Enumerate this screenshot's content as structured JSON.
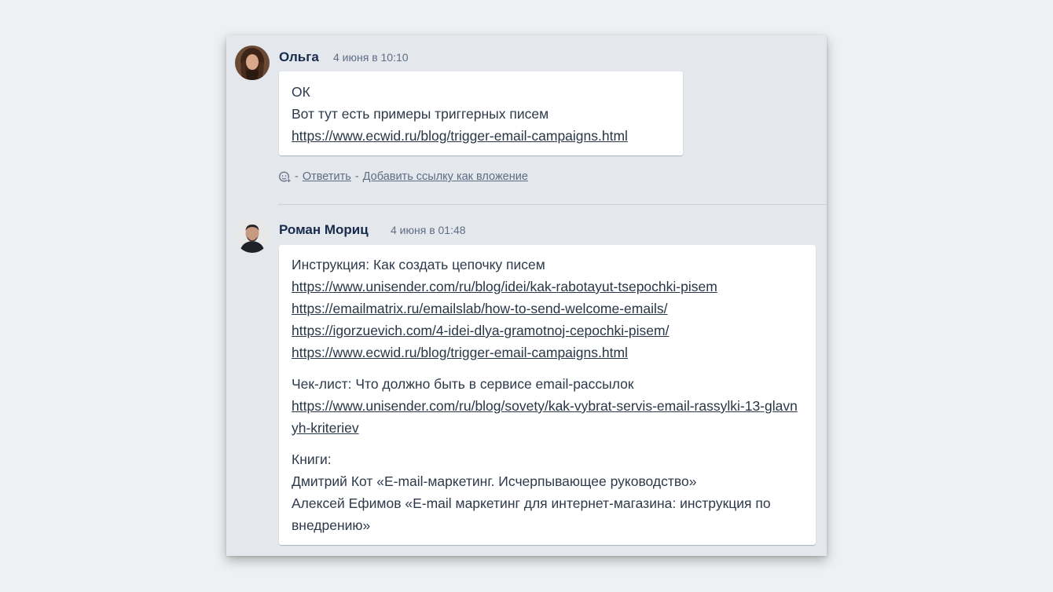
{
  "comments": [
    {
      "author": "Ольга",
      "date": "4 июня в 10:10",
      "avatar_icon": "woman-avatar",
      "lines": [
        {
          "text": "ОК",
          "link": false
        },
        {
          "text": "Вот тут есть примеры триггерных писем",
          "link": false
        },
        {
          "text": "https://www.ecwid.ru/blog/trigger-email-campaigns.html",
          "link": true
        }
      ],
      "actions": {
        "reaction_icon": "add-reaction-icon",
        "dash1": "-",
        "reply": "Ответить",
        "dash2": "-",
        "attach": "Добавить ссылку как вложение"
      }
    },
    {
      "author": "Роман Мориц",
      "date": "4 июня в 01:48",
      "avatar_icon": "man-avatar",
      "paragraphs": [
        [
          {
            "text": "Инструкция: Как создать цепочку писем",
            "link": false
          },
          {
            "text": "https://www.unisender.com/ru/blog/idei/kak-rabotayut-tsepochki-pisem",
            "link": true
          },
          {
            "text": "https://emailmatrix.ru/emailslab/how-to-send-welcome-emails/",
            "link": true
          },
          {
            "text": "https://igorzuevich.com/4-idei-dlya-gramotnoj-cepochki-pisem/",
            "link": true
          },
          {
            "text": "https://www.ecwid.ru/blog/trigger-email-campaigns.html",
            "link": true
          }
        ],
        [
          {
            "text": "Чек-лист: Что должно быть в сервисе email-рассылок",
            "link": false
          },
          {
            "text": "https://www.unisender.com/ru/blog/sovety/kak-vybrat-servis-email-rassylki-13-glavnyh-kriteriev",
            "link": true
          }
        ],
        [
          {
            "text": "Книги:",
            "link": false
          },
          {
            "text": "Дмитрий Кот «E-mail-маркетинг. Исчерпывающее руководство»",
            "link": false
          },
          {
            "text": "Алексей Ефимов «E-mail маркетинг для интернет-магазина: инструкция по внедрению»",
            "link": false
          }
        ]
      ]
    }
  ]
}
